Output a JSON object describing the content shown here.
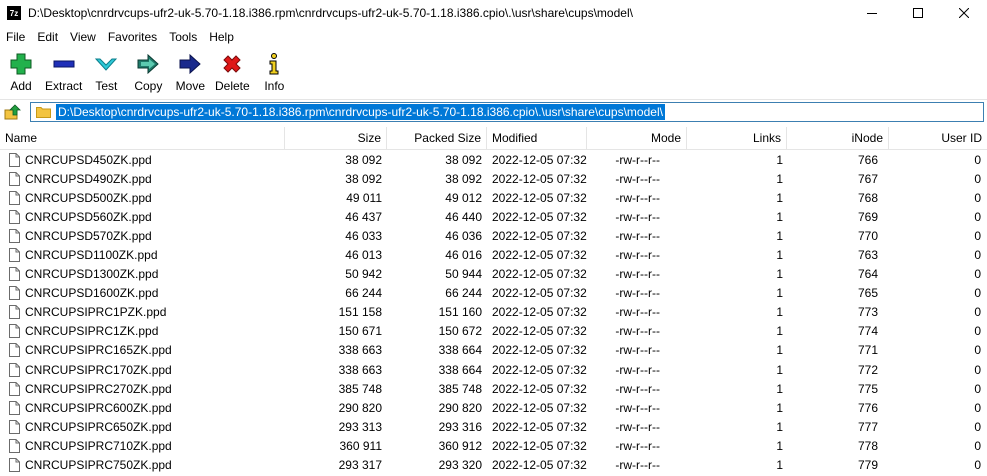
{
  "window": {
    "app_icon": "7z",
    "title": "D:\\Desktop\\cnrdrvcups-ufr2-uk-5.70-1.18.i386.rpm\\cnrdrvcups-ufr2-uk-5.70-1.18.i386.cpio\\.\\usr\\share\\cups\\model\\"
  },
  "menu": [
    "File",
    "Edit",
    "View",
    "Favorites",
    "Tools",
    "Help"
  ],
  "toolbar": [
    {
      "label": "Add",
      "icon": "plus-icon"
    },
    {
      "label": "Extract",
      "icon": "minus-icon"
    },
    {
      "label": "Test",
      "icon": "check-icon"
    },
    {
      "label": "Copy",
      "icon": "copy-arrow-icon"
    },
    {
      "label": "Move",
      "icon": "move-arrow-icon"
    },
    {
      "label": "Delete",
      "icon": "delete-x-icon"
    },
    {
      "label": "Info",
      "icon": "info-icon"
    }
  ],
  "address": {
    "path": "D:\\Desktop\\cnrdrvcups-ufr2-uk-5.70-1.18.i386.rpm\\cnrdrvcups-ufr2-uk-5.70-1.18.i386.cpio\\.\\usr\\share\\cups\\model\\"
  },
  "columns": [
    "Name",
    "Size",
    "Packed Size",
    "Modified",
    "Mode",
    "Links",
    "iNode",
    "User ID"
  ],
  "files": [
    {
      "name": "CNRCUPSD450ZK.ppd",
      "size": "38 092",
      "packed": "38 092",
      "modified": "2022-12-05 07:32",
      "mode": "-rw-r--r--",
      "links": "1",
      "inode": "766",
      "uid": "0"
    },
    {
      "name": "CNRCUPSD490ZK.ppd",
      "size": "38 092",
      "packed": "38 092",
      "modified": "2022-12-05 07:32",
      "mode": "-rw-r--r--",
      "links": "1",
      "inode": "767",
      "uid": "0"
    },
    {
      "name": "CNRCUPSD500ZK.ppd",
      "size": "49 011",
      "packed": "49 012",
      "modified": "2022-12-05 07:32",
      "mode": "-rw-r--r--",
      "links": "1",
      "inode": "768",
      "uid": "0"
    },
    {
      "name": "CNRCUPSD560ZK.ppd",
      "size": "46 437",
      "packed": "46 440",
      "modified": "2022-12-05 07:32",
      "mode": "-rw-r--r--",
      "links": "1",
      "inode": "769",
      "uid": "0"
    },
    {
      "name": "CNRCUPSD570ZK.ppd",
      "size": "46 033",
      "packed": "46 036",
      "modified": "2022-12-05 07:32",
      "mode": "-rw-r--r--",
      "links": "1",
      "inode": "770",
      "uid": "0"
    },
    {
      "name": "CNRCUPSD1100ZK.ppd",
      "size": "46 013",
      "packed": "46 016",
      "modified": "2022-12-05 07:32",
      "mode": "-rw-r--r--",
      "links": "1",
      "inode": "763",
      "uid": "0"
    },
    {
      "name": "CNRCUPSD1300ZK.ppd",
      "size": "50 942",
      "packed": "50 944",
      "modified": "2022-12-05 07:32",
      "mode": "-rw-r--r--",
      "links": "1",
      "inode": "764",
      "uid": "0"
    },
    {
      "name": "CNRCUPSD1600ZK.ppd",
      "size": "66 244",
      "packed": "66 244",
      "modified": "2022-12-05 07:32",
      "mode": "-rw-r--r--",
      "links": "1",
      "inode": "765",
      "uid": "0"
    },
    {
      "name": "CNRCUPSIPRC1PZK.ppd",
      "size": "151 158",
      "packed": "151 160",
      "modified": "2022-12-05 07:32",
      "mode": "-rw-r--r--",
      "links": "1",
      "inode": "773",
      "uid": "0"
    },
    {
      "name": "CNRCUPSIPRC1ZK.ppd",
      "size": "150 671",
      "packed": "150 672",
      "modified": "2022-12-05 07:32",
      "mode": "-rw-r--r--",
      "links": "1",
      "inode": "774",
      "uid": "0"
    },
    {
      "name": "CNRCUPSIPRC165ZK.ppd",
      "size": "338 663",
      "packed": "338 664",
      "modified": "2022-12-05 07:32",
      "mode": "-rw-r--r--",
      "links": "1",
      "inode": "771",
      "uid": "0"
    },
    {
      "name": "CNRCUPSIPRC170ZK.ppd",
      "size": "338 663",
      "packed": "338 664",
      "modified": "2022-12-05 07:32",
      "mode": "-rw-r--r--",
      "links": "1",
      "inode": "772",
      "uid": "0"
    },
    {
      "name": "CNRCUPSIPRC270ZK.ppd",
      "size": "385 748",
      "packed": "385 748",
      "modified": "2022-12-05 07:32",
      "mode": "-rw-r--r--",
      "links": "1",
      "inode": "775",
      "uid": "0"
    },
    {
      "name": "CNRCUPSIPRC600ZK.ppd",
      "size": "290 820",
      "packed": "290 820",
      "modified": "2022-12-05 07:32",
      "mode": "-rw-r--r--",
      "links": "1",
      "inode": "776",
      "uid": "0"
    },
    {
      "name": "CNRCUPSIPRC650ZK.ppd",
      "size": "293 313",
      "packed": "293 316",
      "modified": "2022-12-05 07:32",
      "mode": "-rw-r--r--",
      "links": "1",
      "inode": "777",
      "uid": "0"
    },
    {
      "name": "CNRCUPSIPRC710ZK.ppd",
      "size": "360 911",
      "packed": "360 912",
      "modified": "2022-12-05 07:32",
      "mode": "-rw-r--r--",
      "links": "1",
      "inode": "778",
      "uid": "0"
    },
    {
      "name": "CNRCUPSIPRC750ZK.ppd",
      "size": "293 317",
      "packed": "293 320",
      "modified": "2022-12-05 07:32",
      "mode": "-rw-r--r--",
      "links": "1",
      "inode": "779",
      "uid": "0"
    }
  ],
  "colors": {
    "selection": "#0078d7",
    "address_border": "#3c7fb1",
    "folder": "#f3c441",
    "add_green": "#22b14c",
    "extract_blue": "#1f2fb8",
    "test_cyan": "#2ec9d8",
    "copy_teal": "#1f7a6a",
    "move_navy": "#1a2a8c",
    "delete_red": "#e01818",
    "info_yellow": "#f0d020"
  }
}
